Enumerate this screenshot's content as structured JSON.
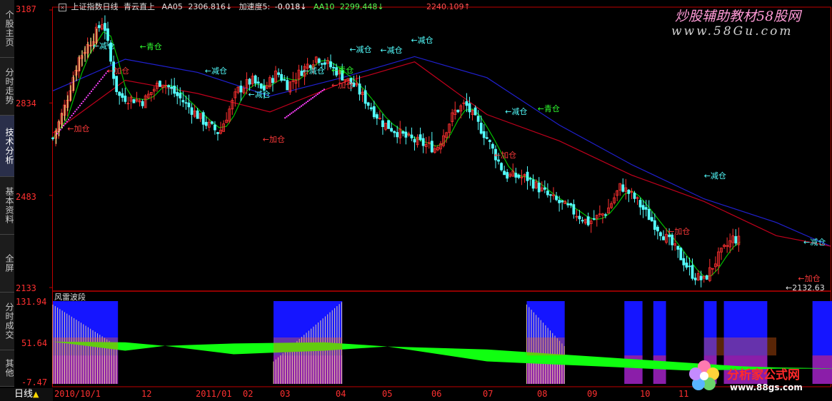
{
  "sidebar": {
    "items": [
      {
        "label": "个股主页"
      },
      {
        "label": "分时走势"
      },
      {
        "label": "技术分析"
      },
      {
        "label": "基本资料"
      },
      {
        "label": "全屏"
      },
      {
        "label": "分时成交"
      },
      {
        "label": "其他"
      }
    ],
    "active_index": 2,
    "bottom_label": "日线"
  },
  "header": {
    "title": "上证指数日线",
    "indicator_name": "青云直上",
    "aa05_label": "AA05",
    "aa05_value": "2306.816↓",
    "speed_label": "加速度5:",
    "speed_value": "-0.018↓",
    "aa10_label": "AA10",
    "aa10_value": "2299.448↓",
    "aa20_value": "2240.109↑"
  },
  "watermarks": {
    "top": "炒股辅助教材58股网",
    "top_url": "www.58Gu.com",
    "bottom": "分析家公式网",
    "bottom_url": "www.88gs.com"
  },
  "lower_panel": {
    "title": "风雷波段"
  },
  "colors": {
    "up": "#ff3030",
    "down": "#54ffff",
    "axis": "#c00000",
    "ma_red": "#c0001c",
    "ma_blue": "#2020d0",
    "ma_green": "#00c000",
    "signal_cyan": "#54ffff",
    "signal_green": "#30ff30",
    "signal_red": "#ff3a3a",
    "blue_bar": "#1515ff",
    "purple_bar": "#a0209a",
    "green_band": "#10ff10"
  },
  "chart_data": [
    {
      "type": "candlestick",
      "title": "上证指数日线",
      "y_ticks": [
        "3187",
        "2834",
        "2483",
        "2133"
      ],
      "ylim": [
        2133,
        3187
      ],
      "x_ticks": [
        "2010/10/1",
        "12",
        "2011/01",
        "02",
        "03",
        "04",
        "05",
        "06",
        "07",
        "08",
        "09",
        "10",
        "11"
      ],
      "last_label": "2132.63",
      "price_path": [
        {
          "d": 0,
          "v": 2700
        },
        {
          "d": 6,
          "v": 2810
        },
        {
          "d": 14,
          "v": 3000
        },
        {
          "d": 22,
          "v": 3080
        },
        {
          "d": 28,
          "v": 3150
        },
        {
          "d": 32,
          "v": 2990
        },
        {
          "d": 36,
          "v": 2860
        },
        {
          "d": 50,
          "v": 2840
        },
        {
          "d": 60,
          "v": 2920
        },
        {
          "d": 72,
          "v": 2840
        },
        {
          "d": 84,
          "v": 2760
        },
        {
          "d": 92,
          "v": 2720
        },
        {
          "d": 102,
          "v": 2880
        },
        {
          "d": 110,
          "v": 2920
        },
        {
          "d": 116,
          "v": 2880
        },
        {
          "d": 124,
          "v": 2950
        },
        {
          "d": 130,
          "v": 2900
        },
        {
          "d": 138,
          "v": 2960
        },
        {
          "d": 146,
          "v": 3010
        },
        {
          "d": 156,
          "v": 2960
        },
        {
          "d": 168,
          "v": 2890
        },
        {
          "d": 182,
          "v": 2760
        },
        {
          "d": 196,
          "v": 2700
        },
        {
          "d": 212,
          "v": 2660
        },
        {
          "d": 222,
          "v": 2800
        },
        {
          "d": 228,
          "v": 2830
        },
        {
          "d": 240,
          "v": 2700
        },
        {
          "d": 250,
          "v": 2560
        },
        {
          "d": 262,
          "v": 2550
        },
        {
          "d": 274,
          "v": 2480
        },
        {
          "d": 286,
          "v": 2430
        },
        {
          "d": 296,
          "v": 2380
        },
        {
          "d": 306,
          "v": 2420
        },
        {
          "d": 314,
          "v": 2520
        },
        {
          "d": 322,
          "v": 2470
        },
        {
          "d": 332,
          "v": 2380
        },
        {
          "d": 344,
          "v": 2280
        },
        {
          "d": 354,
          "v": 2180
        },
        {
          "d": 360,
          "v": 2160
        },
        {
          "d": 368,
          "v": 2250
        },
        {
          "d": 376,
          "v": 2320
        },
        {
          "d": 380,
          "v": 2310
        }
      ],
      "signals": [
        {
          "label": "减仓",
          "d": 22,
          "v": 3055,
          "kind": "reduce"
        },
        {
          "label": "青仓",
          "d": 48,
          "v": 3052,
          "kind": "clear"
        },
        {
          "label": "加仓",
          "d": 30,
          "v": 2960,
          "kind": "add"
        },
        {
          "label": "加仓",
          "d": 8,
          "v": 2740,
          "kind": "add"
        },
        {
          "label": "减仓",
          "d": 84,
          "v": 2960,
          "kind": "reduce"
        },
        {
          "label": "减仓",
          "d": 108,
          "v": 2870,
          "kind": "reduce"
        },
        {
          "label": "加仓",
          "d": 116,
          "v": 2700,
          "kind": "add"
        },
        {
          "label": "减仓",
          "d": 138,
          "v": 2960,
          "kind": "reduce"
        },
        {
          "label": "青仓",
          "d": 154,
          "v": 2962,
          "kind": "clear"
        },
        {
          "label": "加仓",
          "d": 154,
          "v": 2905,
          "kind": "add"
        },
        {
          "label": "减仓",
          "d": 164,
          "v": 3040,
          "kind": "reduce"
        },
        {
          "label": "减仓",
          "d": 181,
          "v": 3039,
          "kind": "reduce"
        },
        {
          "label": "减仓",
          "d": 198,
          "v": 3075,
          "kind": "reduce"
        },
        {
          "label": "减仓",
          "d": 250,
          "v": 2805,
          "kind": "reduce"
        },
        {
          "label": "青仓",
          "d": 268,
          "v": 2815,
          "kind": "clear"
        },
        {
          "label": "加仓",
          "d": 244,
          "v": 2640,
          "kind": "add"
        },
        {
          "label": "减仓",
          "d": 360,
          "v": 2560,
          "kind": "reduce"
        },
        {
          "label": "加仓",
          "d": 340,
          "v": 2350,
          "kind": "add"
        },
        {
          "label": "减仓",
          "d": 415,
          "v": 2310,
          "kind": "reduce"
        },
        {
          "label": "加仓",
          "d": 412,
          "v": 2170,
          "kind": "add"
        }
      ],
      "ma_blue": [
        {
          "d": 0,
          "v": 2880
        },
        {
          "d": 40,
          "v": 3000
        },
        {
          "d": 80,
          "v": 2950
        },
        {
          "d": 120,
          "v": 2860
        },
        {
          "d": 160,
          "v": 2930
        },
        {
          "d": 200,
          "v": 3010
        },
        {
          "d": 240,
          "v": 2930
        },
        {
          "d": 280,
          "v": 2750
        },
        {
          "d": 320,
          "v": 2600
        },
        {
          "d": 360,
          "v": 2470
        },
        {
          "d": 400,
          "v": 2380
        },
        {
          "d": 430,
          "v": 2290
        }
      ],
      "ma_red": [
        {
          "d": 0,
          "v": 2720
        },
        {
          "d": 40,
          "v": 2920
        },
        {
          "d": 80,
          "v": 2870
        },
        {
          "d": 120,
          "v": 2800
        },
        {
          "d": 160,
          "v": 2910
        },
        {
          "d": 200,
          "v": 2990
        },
        {
          "d": 240,
          "v": 2790
        },
        {
          "d": 280,
          "v": 2690
        },
        {
          "d": 320,
          "v": 2560
        },
        {
          "d": 360,
          "v": 2460
        },
        {
          "d": 400,
          "v": 2330
        },
        {
          "d": 430,
          "v": 2290
        }
      ]
    },
    {
      "type": "area",
      "title": "风雷波段",
      "y_ticks": [
        "131.94",
        "51.64",
        "-7.47"
      ],
      "ylim": [
        -7.47,
        131.94
      ],
      "blue_blocks": [
        {
          "from": 0,
          "to": 36
        },
        {
          "from": 122,
          "to": 160
        },
        {
          "from": 262,
          "to": 283
        },
        {
          "from": 316,
          "to": 326
        },
        {
          "from": 332,
          "to": 339
        },
        {
          "from": 360,
          "to": 367
        },
        {
          "from": 371,
          "to": 395
        },
        {
          "from": 420,
          "to": 441
        }
      ],
      "green_band": [
        {
          "d": 0,
          "top": 63,
          "bot": 63
        },
        {
          "d": 40,
          "top": 62,
          "bot": 48
        },
        {
          "d": 62,
          "top": 56,
          "bot": 56
        },
        {
          "d": 100,
          "top": 60,
          "bot": 42
        },
        {
          "d": 150,
          "top": 62,
          "bot": 48
        },
        {
          "d": 185,
          "top": 55,
          "bot": 55
        },
        {
          "d": 240,
          "top": 50,
          "bot": 30
        },
        {
          "d": 300,
          "top": 38,
          "bot": 22
        },
        {
          "d": 350,
          "top": 28,
          "bot": 15
        },
        {
          "d": 380,
          "top": 22,
          "bot": 16
        },
        {
          "d": 400,
          "top": 20,
          "bot": 18
        },
        {
          "d": 440,
          "top": 18,
          "bot": 18
        }
      ]
    }
  ]
}
